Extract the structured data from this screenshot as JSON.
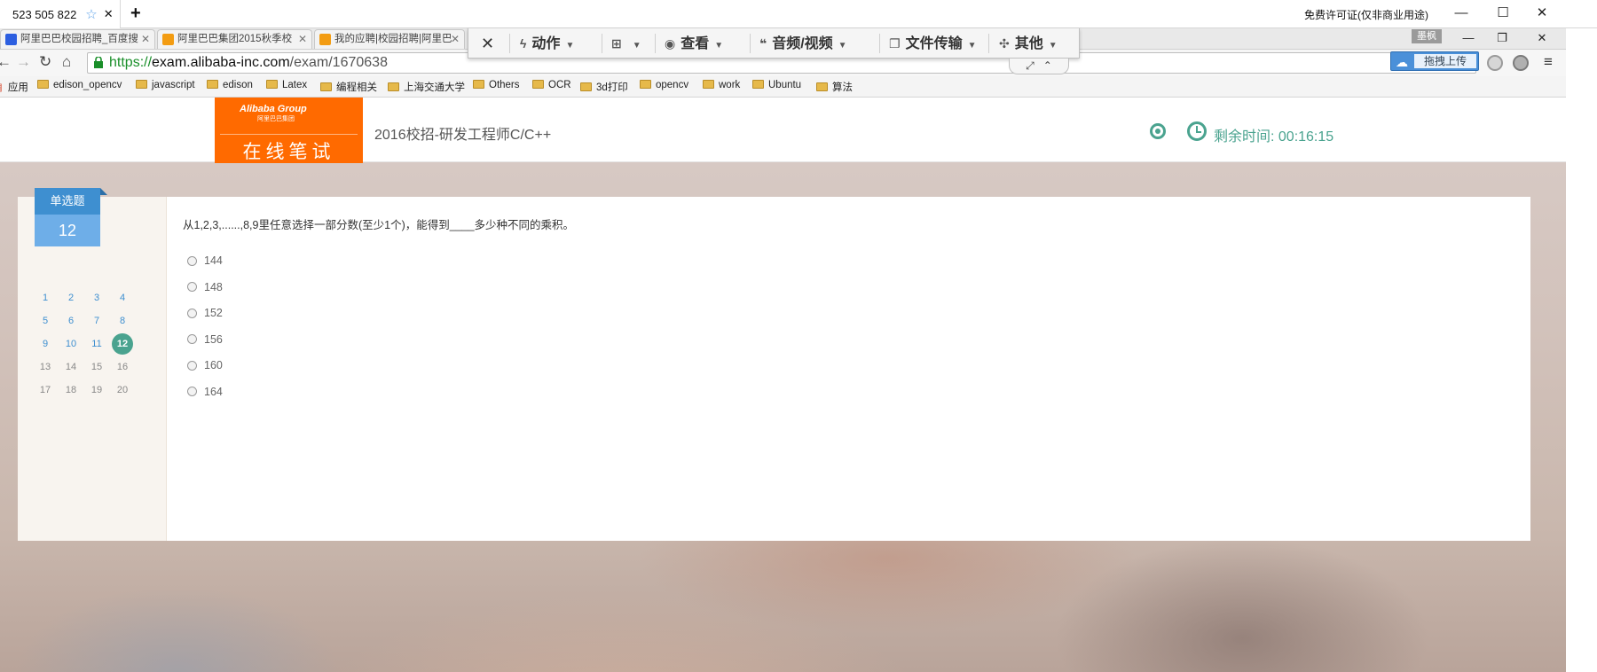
{
  "remote": {
    "session_id": "523 505 822",
    "license_text": "免费许可证(仅非商业用途)",
    "toolbar": {
      "close": "✕",
      "actions": "动作",
      "view": "查看",
      "audio_video": "音频/视频",
      "file_transfer": "文件传输",
      "other": "其他"
    },
    "right_badge": "墨枫"
  },
  "browser": {
    "tabs": [
      {
        "label": "阿里巴巴校园招聘_百度搜"
      },
      {
        "label": "阿里巴巴集团2015秋季校"
      },
      {
        "label": "我的应聘|校园招聘|阿里巴"
      }
    ],
    "url": {
      "scheme": "https://",
      "host": "exam.alibaba-inc.com",
      "path": "/exam/1670638"
    },
    "upload_button": "拖拽上传",
    "cut_text": "\"",
    "bookmarks": [
      {
        "label": "应用",
        "folder": false
      },
      {
        "label": "edison_opencv",
        "folder": true
      },
      {
        "label": "javascript",
        "folder": true
      },
      {
        "label": "edison",
        "folder": true
      },
      {
        "label": "Latex",
        "folder": true
      },
      {
        "label": "编程相关",
        "folder": true
      },
      {
        "label": "上海交通大学",
        "folder": true
      },
      {
        "label": "Others",
        "folder": true
      },
      {
        "label": "OCR",
        "folder": true
      },
      {
        "label": "3d打印",
        "folder": true
      },
      {
        "label": "opencv",
        "folder": true
      },
      {
        "label": "work",
        "folder": true
      },
      {
        "label": "Ubuntu",
        "folder": true
      },
      {
        "label": "算法",
        "folder": true
      }
    ]
  },
  "exam": {
    "logo_brand": "Alibaba Group",
    "logo_sub": "阿里巴巴集团",
    "logo_main": "在线笔试",
    "title": "2016校招-研发工程师C/C++",
    "timer": "剩余时间: 00:16:15",
    "question_type": "单选题",
    "question_number": "12",
    "question_text": "从1,2,3,......,8,9里任意选择一部分数(至少1个)，能得到____多少种不同的乘积。",
    "options": [
      "144",
      "148",
      "152",
      "156",
      "160",
      "164"
    ],
    "nav": [
      {
        "n": "1",
        "state": "done"
      },
      {
        "n": "2",
        "state": "done"
      },
      {
        "n": "3",
        "state": "done"
      },
      {
        "n": "4",
        "state": "done"
      },
      {
        "n": "5",
        "state": "done"
      },
      {
        "n": "6",
        "state": "done"
      },
      {
        "n": "7",
        "state": "done"
      },
      {
        "n": "8",
        "state": "done"
      },
      {
        "n": "9",
        "state": "done"
      },
      {
        "n": "10",
        "state": "done"
      },
      {
        "n": "11",
        "state": "done"
      },
      {
        "n": "12",
        "state": "current"
      },
      {
        "n": "13",
        "state": "todo"
      },
      {
        "n": "14",
        "state": "todo"
      },
      {
        "n": "15",
        "state": "todo"
      },
      {
        "n": "16",
        "state": "todo"
      },
      {
        "n": "17",
        "state": "todo"
      },
      {
        "n": "18",
        "state": "todo"
      },
      {
        "n": "19",
        "state": "todo"
      },
      {
        "n": "20",
        "state": "todo"
      }
    ]
  },
  "colors": {
    "accent_green": "#4aa38f",
    "brand_orange": "#ff6a00",
    "badge_blue": "#3e8fd0"
  }
}
